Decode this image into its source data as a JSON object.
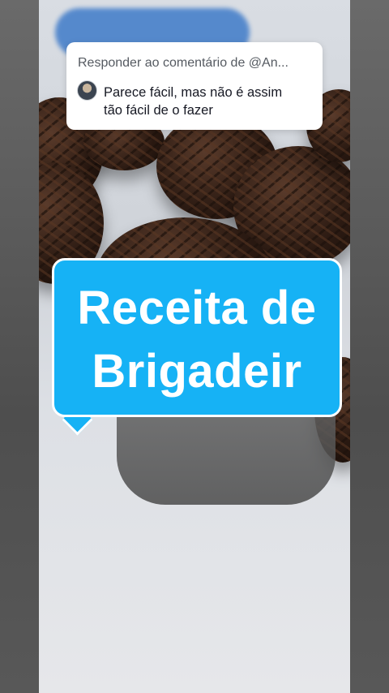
{
  "reply": {
    "header": "Responder ao comentário de @An...",
    "comment_line1": "Parece fácil, mas não é assim",
    "comment_line2": "tão fácil de o  fazer"
  },
  "title": {
    "line1": "Receita de",
    "line2": "Brigadeir"
  },
  "colors": {
    "bubble": "#16b2f5",
    "card": "#ffffff"
  }
}
